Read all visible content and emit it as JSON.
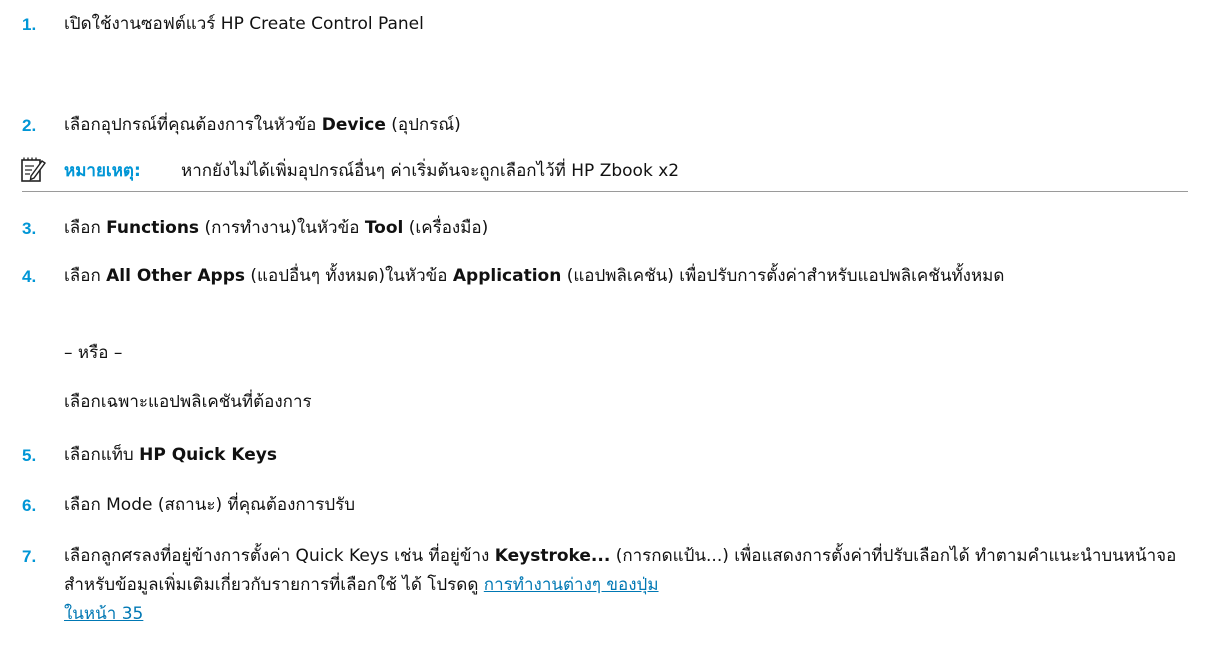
{
  "steps": [
    {
      "number": "1.",
      "text": "เปิดใช้งานซอฟต์แวร์ HP Create Control Panel"
    },
    {
      "number": "2.",
      "pre": "เลือกอุปกรณ์ที่คุณต้องการในหัวข้อ ",
      "bold": "Device",
      "post": " (อุปกรณ์)"
    },
    {
      "number": "3.",
      "pre": "เลือก ",
      "bold1": "Functions",
      "mid": " (การทำงาน)ในหัวข้อ ",
      "bold2": "Tool",
      "post": " (เครื่องมือ)"
    },
    {
      "number": "4.",
      "pre": "เลือก ",
      "bold1": "All Other Apps",
      "mid": " (แอปอื่นๆ ทั้งหมด)ในหัวข้อ ",
      "bold2": "Application",
      "post": " (แอปพลิเคชัน) เพื่อปรับการตั้งค่าสำหรับแอปพลิเคชันทั้งหมด",
      "or": "– หรือ –",
      "alt": "เลือกเฉพาะแอปพลิเคชันที่ต้องการ"
    },
    {
      "number": "5.",
      "pre": "เลือกแท็บ ",
      "bold": "HP Quick Keys"
    },
    {
      "number": "6.",
      "text": "เลือก Mode (สถานะ) ที่คุณต้องการปรับ"
    },
    {
      "number": "7.",
      "pre": "เลือกลูกศรลงที่อยู่ข้างการตั้งค่า Quick Keys เช่น ที่อยู่ข้าง ",
      "bold": "Keystroke...",
      "post": " (การกดแป้น...) เพื่อแสดงการตั้งค่าที่ปรับเลือกได้ ทำตามคำแนะนำบนหน้าจอ สำหรับข้อมูลเพิ่มเติมเกี่ยวกับรายการที่เลือกใช้ ได้ โปรดดู ",
      "link": "การทำงานต่างๆ ของปุ่ม",
      "link_page": "ในหน้า 35"
    }
  ],
  "note": {
    "icon": "note-pencil-icon",
    "label": "หมายเหตุ:",
    "text": "หากยังไม่ได้เพิ่มอุปกรณ์อื่นๆ ค่าเริ่มต้นจะถูกเลือกไว้ที่ HP Zbook x2"
  },
  "colors": {
    "accent": "#0096d6",
    "link": "#0078b4",
    "text": "#111111"
  }
}
